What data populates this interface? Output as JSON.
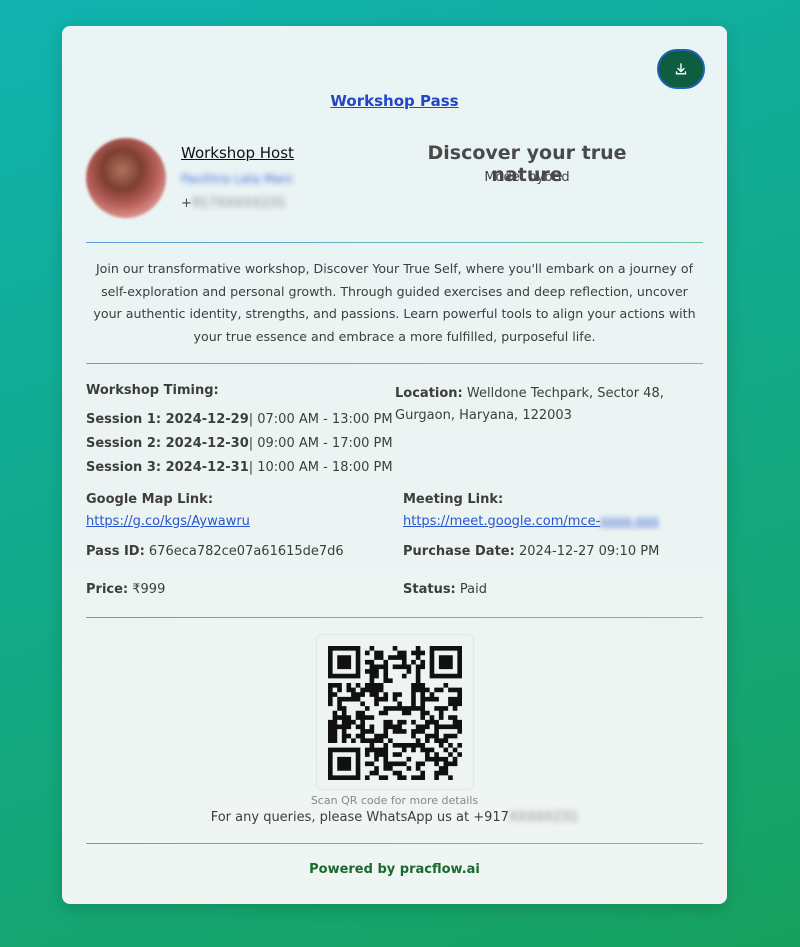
{
  "pass": {
    "title": "Workshop Pass",
    "download_icon": "download-icon"
  },
  "host": {
    "label": "Workshop Host",
    "name": "Pavithra Lata Mani",
    "phone_prefix": "+",
    "phone_rest": "917XXXXX231"
  },
  "workshop": {
    "title": "Discover your true nature",
    "mode": "Mode: hybrid",
    "description": "Join our transformative workshop, Discover Your True Self, where you'll embark on a journey of self-exploration and personal growth. Through guided exercises and deep reflection, uncover your authentic identity, strengths, and passions. Learn powerful tools to align your actions with your true essence and embrace a more fulfilled, purposeful life."
  },
  "timing": {
    "label": "Workshop Timing:",
    "sessions": [
      {
        "label": "Session 1: 2024-12-29",
        "time": "| 07:00 AM - 13:00 PM"
      },
      {
        "label": "Session 2: 2024-12-30",
        "time": "| 09:00 AM - 17:00 PM"
      },
      {
        "label": "Session 3: 2024-12-31",
        "time": "| 10:00 AM - 18:00 PM"
      }
    ]
  },
  "location": {
    "label": "Location:",
    "line1": " Welldone Techpark, Sector 48,",
    "line2": "Gurgaon, Haryana, 122003"
  },
  "map": {
    "label": "Google Map Link:",
    "url": "https://g.co/kgs/Aywawru"
  },
  "meeting": {
    "label": "Meeting Link:",
    "url_visible": "https://meet.google.com/mce-",
    "url_hidden": "xxxx-xxx"
  },
  "pass_id": {
    "label": "Pass ID:",
    "value": " 676eca782ce07a61615de7d6"
  },
  "purchase_date": {
    "label": "Purchase Date:",
    "value": " 2024-12-27 09:10 PM"
  },
  "price": {
    "label": "Price:",
    "value": " ₹999"
  },
  "status": {
    "label": "Status:",
    "value": " Paid"
  },
  "qr": {
    "caption": "Scan QR code for more details"
  },
  "contact": {
    "text": "For any queries, please WhatsApp us at +917",
    "hidden": "XXXXX231"
  },
  "footer": {
    "powered": "Powered by pracflow.ai"
  },
  "colors": {
    "accent": "#2146c7",
    "button": "#0f5d40",
    "footer_text": "#1a6a2e"
  }
}
